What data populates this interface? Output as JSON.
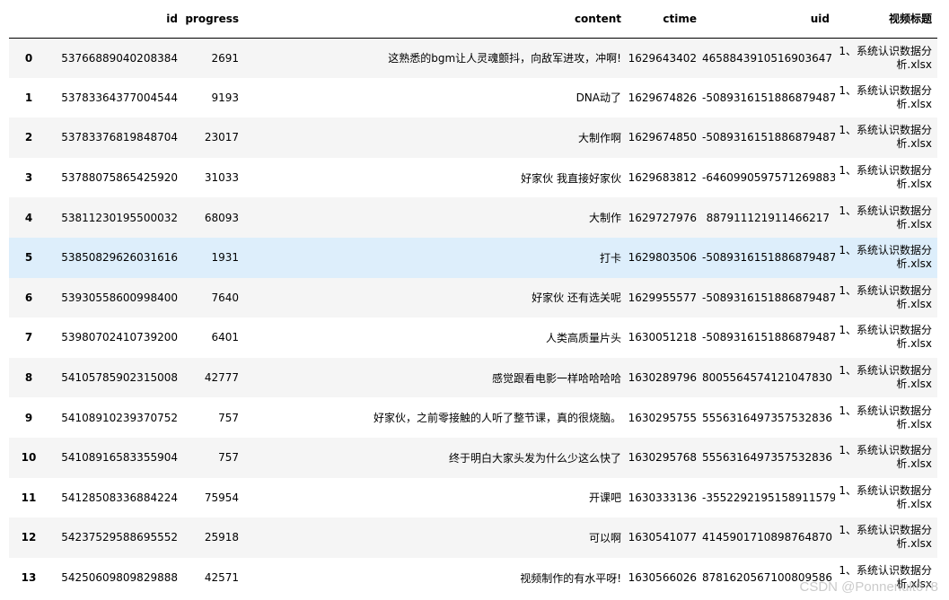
{
  "table": {
    "columns": {
      "index": "",
      "id": "id",
      "progress": "progress",
      "content": "content",
      "ctime": "ctime",
      "uid": "uid",
      "title": "视频标题"
    },
    "hovered_row": 5,
    "rows": [
      {
        "index": "0",
        "id": "53766889040208384",
        "progress": "2691",
        "content": "这熟悉的bgm让人灵魂颤抖，向敌军进攻，冲啊!",
        "ctime": "1629643402",
        "uid": "4658843910516903647",
        "title": "1、系统认识数据分析.xlsx"
      },
      {
        "index": "1",
        "id": "53783364377004544",
        "progress": "9193",
        "content": "DNA动了",
        "ctime": "1629674826",
        "uid": "-5089316151886879487",
        "title": "1、系统认识数据分析.xlsx"
      },
      {
        "index": "2",
        "id": "53783376819848704",
        "progress": "23017",
        "content": "大制作啊",
        "ctime": "1629674850",
        "uid": "-5089316151886879487",
        "title": "1、系统认识数据分析.xlsx"
      },
      {
        "index": "3",
        "id": "53788075865425920",
        "progress": "31033",
        "content": "好家伙 我直接好家伙",
        "ctime": "1629683812",
        "uid": "-6460990597571269883",
        "title": "1、系统认识数据分析.xlsx"
      },
      {
        "index": "4",
        "id": "53811230195500032",
        "progress": "68093",
        "content": "大制作",
        "ctime": "1629727976",
        "uid": "887911121911466217",
        "title": "1、系统认识数据分析.xlsx"
      },
      {
        "index": "5",
        "id": "53850829626031616",
        "progress": "1931",
        "content": "打卡",
        "ctime": "1629803506",
        "uid": "-5089316151886879487",
        "title": "1、系统认识数据分析.xlsx"
      },
      {
        "index": "6",
        "id": "53930558600998400",
        "progress": "7640",
        "content": "好家伙 还有选关呢",
        "ctime": "1629955577",
        "uid": "-5089316151886879487",
        "title": "1、系统认识数据分析.xlsx"
      },
      {
        "index": "7",
        "id": "53980702410739200",
        "progress": "6401",
        "content": "人类高质量片头",
        "ctime": "1630051218",
        "uid": "-5089316151886879487",
        "title": "1、系统认识数据分析.xlsx"
      },
      {
        "index": "8",
        "id": "54105785902315008",
        "progress": "42777",
        "content": "感觉跟看电影一样哈哈哈哈",
        "ctime": "1630289796",
        "uid": "8005564574121047830",
        "title": "1、系统认识数据分析.xlsx"
      },
      {
        "index": "9",
        "id": "54108910239370752",
        "progress": "757",
        "content": "好家伙，之前零接触的人听了整节课，真的很烧脑。",
        "ctime": "1630295755",
        "uid": "5556316497357532836",
        "title": "1、系统认识数据分析.xlsx"
      },
      {
        "index": "10",
        "id": "54108916583355904",
        "progress": "757",
        "content": "终于明白大家头发为什么少这么快了",
        "ctime": "1630295768",
        "uid": "5556316497357532836",
        "title": "1、系统认识数据分析.xlsx"
      },
      {
        "index": "11",
        "id": "54128508336884224",
        "progress": "75954",
        "content": "开课吧",
        "ctime": "1630333136",
        "uid": "-3552292195158911579",
        "title": "1、系统认识数据分析.xlsx"
      },
      {
        "index": "12",
        "id": "54237529588695552",
        "progress": "25918",
        "content": "可以啊",
        "ctime": "1630541077",
        "uid": "4145901710898764870",
        "title": "1、系统认识数据分析.xlsx"
      },
      {
        "index": "13",
        "id": "54250609809829888",
        "progress": "42571",
        "content": "视频制作的有水平呀!",
        "ctime": "1630566026",
        "uid": "8781620567100809586",
        "title": "1、系统认识数据分析.xlsx"
      }
    ]
  },
  "watermark": "CSDN @Ponnenult678"
}
